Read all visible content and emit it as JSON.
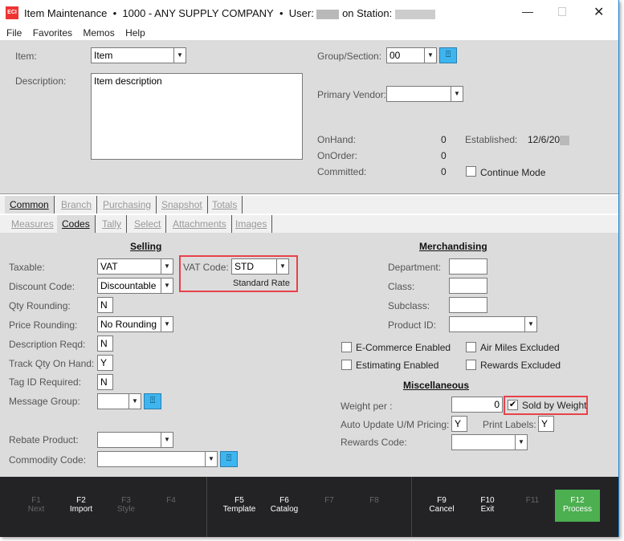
{
  "window": {
    "title": "Item Maintenance",
    "sep": "•",
    "company": "1000 - ANY SUPPLY COMPANY",
    "user_label": "User:",
    "station_label": "on Station:",
    "logo": "ECI"
  },
  "menu": [
    "File",
    "Favorites",
    "Memos",
    "Help"
  ],
  "header": {
    "item_label": "Item:",
    "item_value": "Item",
    "description_label": "Description:",
    "description_value": "Item description",
    "group_label": "Group/Section:",
    "group_value": "00",
    "vendor_label": "Primary Vendor:",
    "vendor_value": "",
    "onhand_label": "OnHand:",
    "onhand": "0",
    "onorder_label": "OnOrder:",
    "onorder": "0",
    "committed_label": "Committed:",
    "committed": "0",
    "established_label": "Established:",
    "established": "12/6/20",
    "continue_mode": "Continue Mode"
  },
  "tabs": [
    {
      "label": "Common",
      "active": true
    },
    {
      "label": "Branch"
    },
    {
      "label": "Purchasing"
    },
    {
      "label": "Snapshot"
    },
    {
      "label": "Totals"
    }
  ],
  "subtabs": [
    {
      "label": "Measures"
    },
    {
      "label": "Codes",
      "active": true
    },
    {
      "label": "Tally"
    },
    {
      "label": "Select"
    },
    {
      "label": "Attachments"
    },
    {
      "label": "Images"
    }
  ],
  "selling": {
    "title": "Selling",
    "taxable_label": "Taxable:",
    "taxable": "VAT",
    "vat_label": "VAT Code:",
    "vat": "STD",
    "vat_desc": "Standard Rate",
    "discount_label": "Discount Code:",
    "discount": "Discountable",
    "qty_round_label": "Qty Rounding:",
    "qty_round": "N",
    "price_round_label": "Price Rounding:",
    "price_round": "No Rounding",
    "desc_reqd_label": "Description Reqd:",
    "desc_reqd": "N",
    "track_label": "Track Qty On Hand:",
    "track": "Y",
    "tag_label": "Tag ID Required:",
    "tag": "N",
    "msg_label": "Message Group:",
    "msg": "",
    "rebate_label": "Rebate Product:",
    "rebate": "",
    "commodity_label": "Commodity Code:",
    "commodity": ""
  },
  "merch": {
    "title": "Merchandising",
    "department_label": "Department:",
    "class_label": "Class:",
    "subclass_label": "Subclass:",
    "product_label": "Product ID:",
    "ecommerce": "E-Commerce Enabled",
    "airmiles": "Air Miles Excluded",
    "estimating": "Estimating Enabled",
    "rewards_excl": "Rewards Excluded"
  },
  "misc": {
    "title": "Miscellaneous",
    "weight_label": "Weight per :",
    "weight": "0",
    "sold_by_weight": "Sold by Weight",
    "sold_by_weight_checked": true,
    "auto_label": "Auto Update U/M Pricing:",
    "auto": "Y",
    "print_label": "Print Labels:",
    "print": "Y",
    "rewards_label": "Rewards Code:",
    "rewards": ""
  },
  "fkeys": [
    {
      "key": "F1",
      "label": "Next",
      "enabled": false
    },
    {
      "key": "F2",
      "label": "Import",
      "enabled": true
    },
    {
      "key": "F3",
      "label": "Style",
      "enabled": false
    },
    {
      "key": "F4",
      "label": "",
      "enabled": false
    },
    {
      "key": "F5",
      "label": "Template",
      "enabled": true
    },
    {
      "key": "F6",
      "label": "Catalog",
      "enabled": true
    },
    {
      "key": "F7",
      "label": "",
      "enabled": false
    },
    {
      "key": "F8",
      "label": "",
      "enabled": false
    },
    {
      "key": "F9",
      "label": "Cancel",
      "enabled": true
    },
    {
      "key": "F10",
      "label": "Exit",
      "enabled": true
    },
    {
      "key": "F11",
      "label": "",
      "enabled": false
    },
    {
      "key": "F12",
      "label": "Process",
      "enabled": true
    }
  ],
  "colors": {
    "accent": "#4caf50",
    "highlight": "#e8424a",
    "lookup": "#3fb5ef",
    "footer": "#232326"
  }
}
